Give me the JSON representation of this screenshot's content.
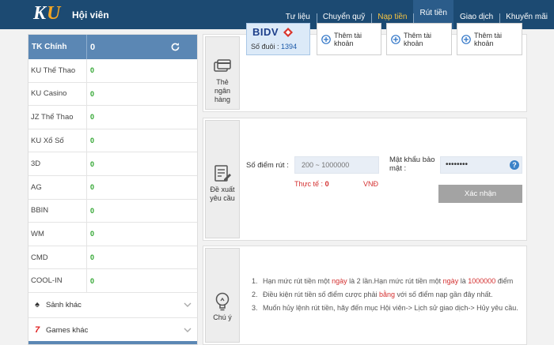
{
  "header": {
    "logo_k": "K",
    "logo_u": "U",
    "title": "Hội viên",
    "nav": [
      "Tư liệu",
      "Chuyển quỹ",
      "Nạp tiền",
      "Rút tiền",
      "Giao dịch",
      "Khuyến mãi"
    ],
    "active_nav": "Rút tiền",
    "nav_highlight": "Nạp tiền"
  },
  "sidebar": {
    "main_account": {
      "label": "TK Chính",
      "value": "0"
    },
    "accounts": [
      {
        "label": "KU Thể Thao",
        "value": "0"
      },
      {
        "label": "KU Casino",
        "value": "0"
      },
      {
        "label": "JZ Thể Thao",
        "value": "0"
      },
      {
        "label": "KU Xổ Số",
        "value": "0"
      },
      {
        "label": "3D",
        "value": "0"
      },
      {
        "label": "AG",
        "value": "0"
      },
      {
        "label": "BBIN",
        "value": "0"
      },
      {
        "label": "WM",
        "value": "0"
      },
      {
        "label": "CMD",
        "value": "0"
      },
      {
        "label": "COOL-IN",
        "value": "0"
      }
    ],
    "groups": [
      {
        "label": "Sảnh khác",
        "icon": "spade-icon"
      },
      {
        "label": "Games khác",
        "icon": "seven-icon"
      }
    ]
  },
  "bank_panel": {
    "tab_label": "Thẻ ngân hàng",
    "bank": {
      "name": "BIDV",
      "suffix_label": "Số đuôi :",
      "suffix_value": "1394"
    },
    "add_accounts": [
      "Thêm tài khoản",
      "Thêm tài khoản",
      "Thêm tài khoản"
    ]
  },
  "withdraw_panel": {
    "tab_label": "Đề xuất yêu cầu",
    "amount_label": "Số điểm rút :",
    "amount_placeholder": "200 ~ 1000000",
    "password_label": "Mật khẩu bảo mật :",
    "password_value": "••••••••",
    "actual_label": "Thực tế :",
    "actual_value": "0",
    "currency": "VNĐ",
    "confirm_label": "Xác nhận"
  },
  "note_panel": {
    "tab_label": "Chú ý",
    "notes": [
      {
        "n": "1.",
        "parts": [
          "Hạn mức rút tiền một ",
          "ngày",
          " là 2 lần.Hạn mức rút tiền một ",
          "ngày",
          " là ",
          "1000000",
          " điểm"
        ]
      },
      {
        "n": "2.",
        "parts": [
          "Điều kiện rút tiền số điểm cược phải ",
          "bằng",
          " với số điểm nạp gần đây nhất."
        ]
      },
      {
        "n": "3.",
        "parts": [
          "Muốn hủy lệnh rút tiền, hãy đến mục Hội viên-> Lịch sử giao dịch-> Hủy yêu cầu."
        ]
      }
    ]
  },
  "colors": {
    "header_bg": "#1c4a72",
    "sidebar_head": "#5b87b4",
    "value_green": "#2aa32a",
    "accent_red": "#d43030",
    "nav_yellow": "#f5c342"
  }
}
